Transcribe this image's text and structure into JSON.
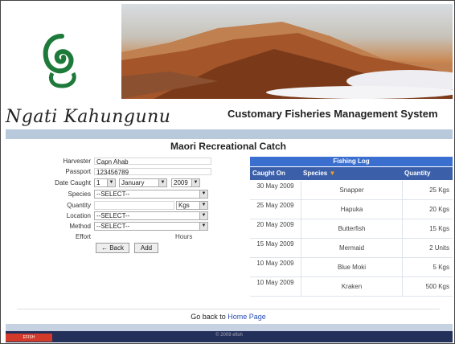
{
  "header": {
    "brand": "Ngati Kahungunu",
    "system_title": "Customary Fisheries Management System"
  },
  "page_title": "Maori Recreational Catch",
  "form": {
    "harvester_label": "Harvester",
    "harvester_value": "Capn Ahab",
    "passport_label": "Passport",
    "passport_value": "123456789",
    "date_label": "Date Caught",
    "day_value": "1",
    "month_value": "January",
    "year_value": "2009",
    "species_label": "Species",
    "species_value": "--SELECT--",
    "quantity_label": "Quantity",
    "unit_value": "Kgs",
    "location_label": "Location",
    "location_value": "--SELECT--",
    "method_label": "Method",
    "method_value": "--SELECT--",
    "effort_label": "Effort",
    "effort_unit": "Hours",
    "back_label": "← Back",
    "add_label": "Add"
  },
  "log": {
    "title": "Fishing Log",
    "columns": [
      "Caught On",
      "Species",
      "Quantity"
    ],
    "rows": [
      {
        "date": "30 May 2009",
        "species": "Snapper",
        "qty": "25 Kgs"
      },
      {
        "date": "25 May 2009",
        "species": "Hapuka",
        "qty": "20 Kgs"
      },
      {
        "date": "20 May 2009",
        "species": "Butterfish",
        "qty": "15 Kgs"
      },
      {
        "date": "15 May 2009",
        "species": "Mermaid",
        "qty": "2 Units"
      },
      {
        "date": "10 May 2009",
        "species": "Blue Moki",
        "qty": "5 Kgs"
      },
      {
        "date": "10 May 2009",
        "species": "Kraken",
        "qty": "500 Kgs"
      }
    ]
  },
  "footer": {
    "go_back_prefix": "Go back to",
    "home_link": "Home Page",
    "copyright": "© 2009 efish"
  },
  "colors": {
    "table_title_bg": "#3a6fcf",
    "table_header_bg": "#3b5fa8",
    "sort_arrow": "#f0a030",
    "footer_bg": "#23305a"
  },
  "icons": {
    "logo": "koru-logo-icon",
    "sort": "sort-desc-icon",
    "dropdown": "chevron-down-icon"
  }
}
